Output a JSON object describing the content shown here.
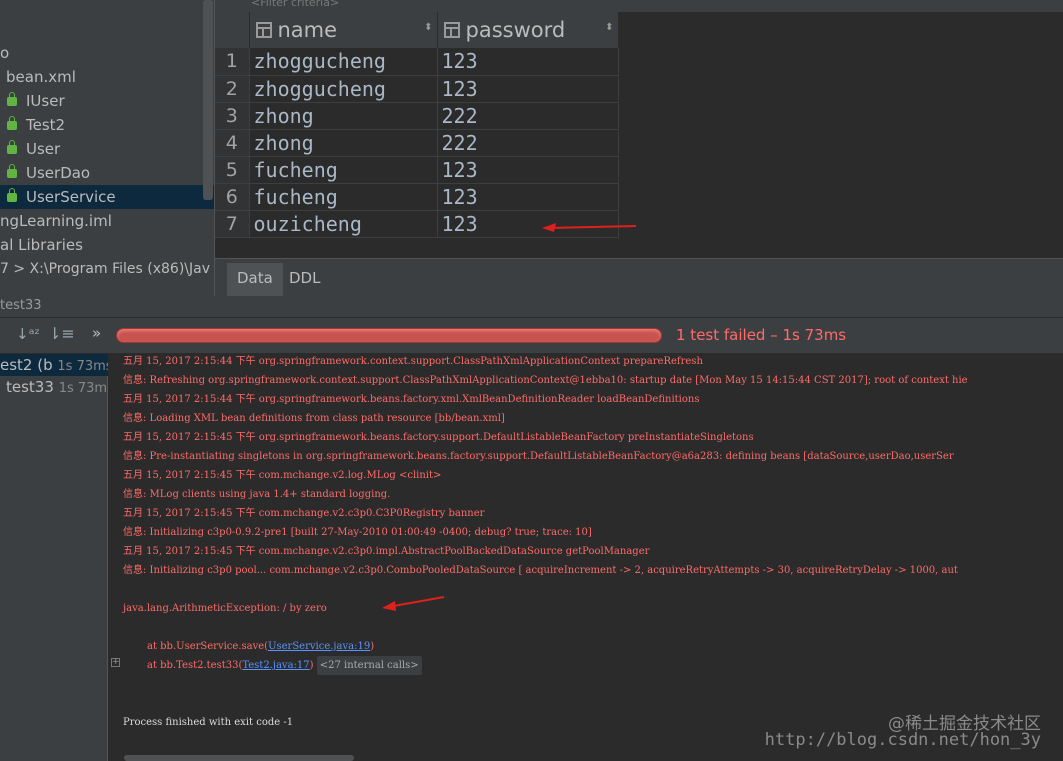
{
  "project_tree": {
    "items": [
      {
        "label": "o",
        "icon": ""
      },
      {
        "label": "bean.xml",
        "icon": ""
      },
      {
        "label": "IUser",
        "icon": "lock-icon"
      },
      {
        "label": "Test2",
        "icon": "lock-icon"
      },
      {
        "label": "User",
        "icon": "lock-icon"
      },
      {
        "label": "UserDao",
        "icon": "lock-icon"
      },
      {
        "label": "UserService",
        "icon": "lock-icon",
        "selected": true
      },
      {
        "label": "ngLearning.iml",
        "icon": ""
      },
      {
        "label": "al Libraries",
        "icon": ""
      },
      {
        "label": "7 >  X:\\Program Files (x86)\\Jav",
        "icon": ""
      }
    ]
  },
  "editor": {
    "filter_placeholder": "<Filter criteria>",
    "columns": [
      "name",
      "password"
    ],
    "rows": [
      {
        "num": "1",
        "name": "zhoggucheng",
        "password": "123"
      },
      {
        "num": "2",
        "name": "zhoggucheng",
        "password": "123"
      },
      {
        "num": "3",
        "name": "zhong",
        "password": "222"
      },
      {
        "num": "4",
        "name": "zhong",
        "password": "222"
      },
      {
        "num": "5",
        "name": "fucheng",
        "password": "123"
      },
      {
        "num": "6",
        "name": "fucheng",
        "password": "123"
      },
      {
        "num": "7",
        "name": "ouzicheng",
        "password": "123"
      }
    ],
    "tabs": [
      "Data",
      "DDL"
    ]
  },
  "run": {
    "title": "test33",
    "status": "1 test failed – 1s 73ms",
    "status_color": "#ff6b68",
    "progress_color": "#c75450",
    "tests": [
      {
        "label": "est2 (b",
        "time": "1s 73ms"
      },
      {
        "label": "test33",
        "time": "1s 73ms"
      }
    ]
  },
  "console": {
    "lines": [
      "五月 15, 2017 2:15:44 下午 org.springframework.context.support.ClassPathXmlApplicationContext prepareRefresh",
      "信息: Refreshing org.springframework.context.support.ClassPathXmlApplicationContext@1ebba10: startup date [Mon May 15 14:15:44 CST 2017]; root of context hie",
      "五月 15, 2017 2:15:44 下午 org.springframework.beans.factory.xml.XmlBeanDefinitionReader loadBeanDefinitions",
      "信息: Loading XML bean definitions from class path resource [bb/bean.xml]",
      "五月 15, 2017 2:15:45 下午 org.springframework.beans.factory.support.DefaultListableBeanFactory preInstantiateSingletons",
      "信息: Pre-instantiating singletons in org.springframework.beans.factory.support.DefaultListableBeanFactory@a6a283: defining beans [dataSource,userDao,userSer",
      "五月 15, 2017 2:15:45 下午 com.mchange.v2.log.MLog <clinit>",
      "信息: MLog clients using java 1.4+ standard logging.",
      "五月 15, 2017 2:15:45 下午 com.mchange.v2.c3p0.C3P0Registry banner",
      "信息: Initializing c3p0-0.9.2-pre1 [built 27-May-2010 01:00:49 -0400; debug? true; trace: 10]",
      "五月 15, 2017 2:15:45 下午 com.mchange.v2.c3p0.impl.AbstractPoolBackedDataSource getPoolManager",
      "信息: Initializing c3p0 pool... com.mchange.v2.c3p0.ComboPooledDataSource [ acquireIncrement -> 2, acquireRetryAttempts -> 30, acquireRetryDelay -> 1000, aut"
    ],
    "exception": "java.lang.ArithmeticException: / by zero",
    "trace1_prefix": "at bb.UserService.save(",
    "trace1_link": "UserService.java:19",
    "trace1_suffix": ")",
    "trace2_prefix": "at bb.Test2.test33(",
    "trace2_link": "Test2.java:17",
    "trace2_suffix": ")",
    "trace2_internal": "<27 internal calls>",
    "exit": "Process finished with exit code -1"
  },
  "watermark": {
    "line1": "@稀土掘金技术社区",
    "line2": "http://blog.csdn.net/hon_3y"
  },
  "annotation_color": "#e0201c"
}
